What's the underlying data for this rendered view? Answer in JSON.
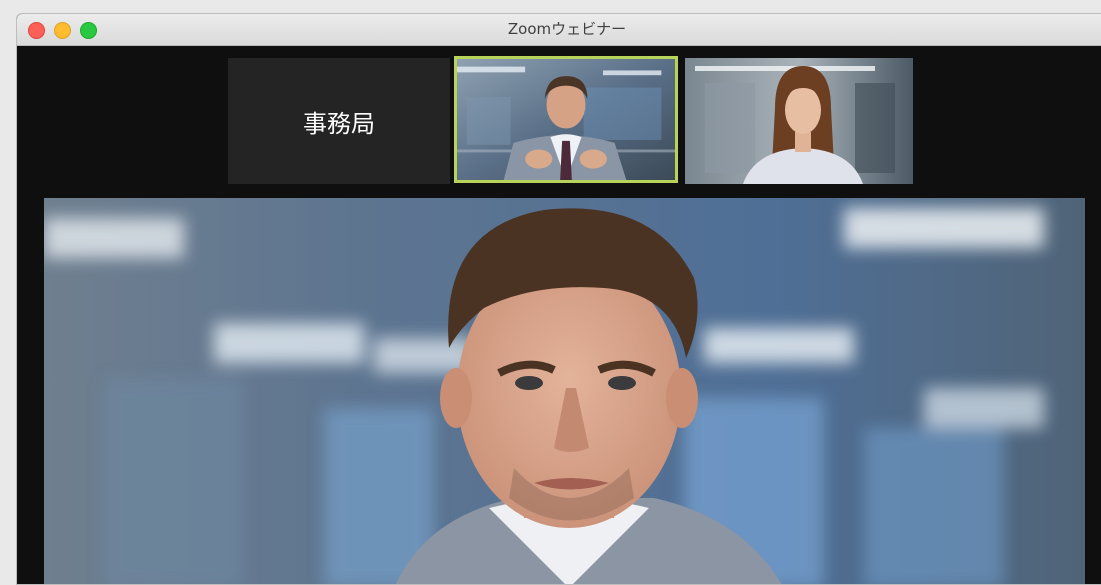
{
  "window": {
    "title": "Zoomウェビナー",
    "controls": [
      "close",
      "minimize",
      "zoom"
    ]
  },
  "participants": [
    {
      "label": "事務局",
      "video": false
    },
    {
      "video": true,
      "active_speaker": true,
      "thumbnail": "man-in-gray-suit"
    },
    {
      "video": true,
      "active_speaker": false,
      "thumbnail": "woman-with-long-hair"
    }
  ],
  "main_video": {
    "subject": "man-in-gray-suit-closeup"
  },
  "colors": {
    "background": "#0f0f0f",
    "active_speaker_border": "#b7d35a",
    "name_tile": "#242424"
  }
}
